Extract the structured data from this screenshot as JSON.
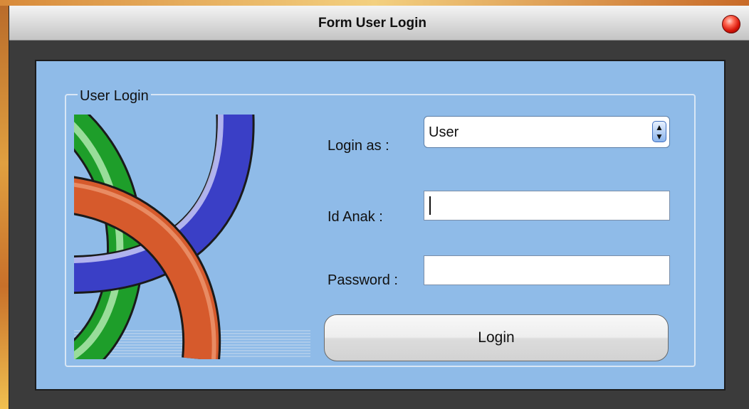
{
  "window": {
    "title": "Form User Login",
    "close_icon": "close-icon",
    "colors": {
      "client_bg": "#8fbbe8",
      "frame": "#3b3b3b",
      "close": "#d8160a"
    }
  },
  "group": {
    "legend": "User Login",
    "decoration_icon": "ribbons-logo-icon"
  },
  "form": {
    "login_as_label": "Login as :",
    "login_as_value": "User",
    "id_anak_label": "Id Anak :",
    "id_anak_value": "",
    "password_label": "Password :",
    "password_value": "",
    "login_button": "Login"
  }
}
